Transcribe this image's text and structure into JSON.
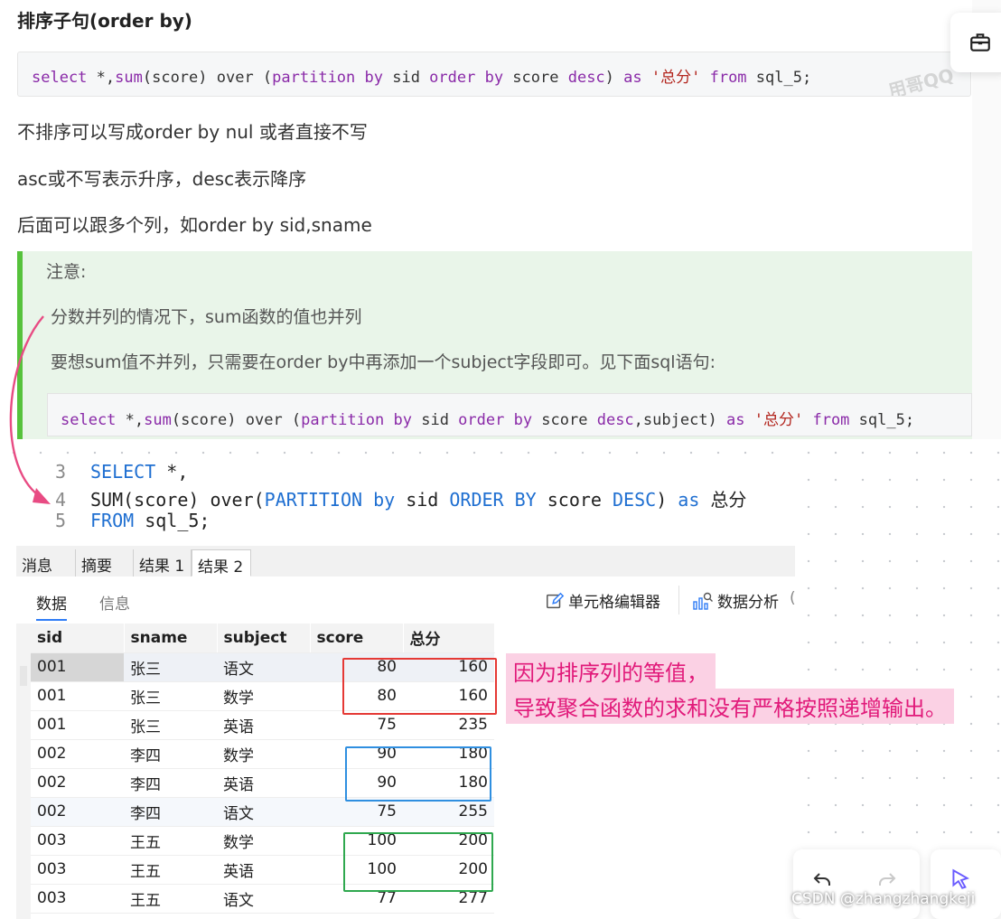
{
  "section_title": "排序子句(order by)",
  "code1": {
    "t1": "select",
    "t2": " *,",
    "t3": "sum",
    "t4": "(score) over (",
    "t5": "partition by",
    "t6": " sid ",
    "t7": "order by",
    "t8": " score ",
    "t9": "desc",
    "t10": ") ",
    "t11": "as",
    "t12": " '总分' ",
    "t13": "from",
    "t14": " sql_5;"
  },
  "paragraphs": {
    "p1": "不排序可以写成order by nul 或者直接不写",
    "p2": "asc或不写表示升序，desc表示降序",
    "p3": "后面可以跟多个列，如order by sid,sname"
  },
  "note": {
    "title": "注意:",
    "line1": "分数并列的情况下，sum函数的值也并列",
    "line2": "要想sum值不并列，只需要在order by中再添加一个subject字段即可。见下面sql语句:",
    "code": {
      "t1": "select",
      "t2": " *,",
      "t3": "sum",
      "t4": "(score) over (",
      "t5": "partition by",
      "t6": " sid ",
      "t7": "order by",
      "t8": " score ",
      "t9": "desc",
      "t10": ",subject) ",
      "t11": "as",
      "t12": " '总分' ",
      "t13": "from",
      "t14": " sql_5;"
    }
  },
  "watermark": "用哥QQ",
  "editor": {
    "lines": [
      {
        "num": "3",
        "k1": "SELECT",
        "p1": " *,",
        "k2": "",
        "p2": "",
        "k3": "",
        "p3": "",
        "k4": "",
        "p4": "",
        "k5": "",
        "p5": ""
      },
      {
        "num": "4",
        "k1": "",
        "p1": "SUM(score) over(",
        "k2": "PARTITION",
        "p2": " ",
        "k3": "by",
        "p3": " sid ",
        "k4": "ORDER BY",
        "p4": " score ",
        "k5": "DESC",
        "p5": ") "
      },
      {
        "num": "5",
        "k1": "FROM",
        "p1": " sql_5;",
        "k2": "",
        "p2": "",
        "k3": "",
        "p3": "",
        "k4": "",
        "p4": "",
        "k5": "",
        "p5": ""
      }
    ],
    "line4_tail_kw": "as",
    "line4_tail": " 总分"
  },
  "result_tabs": [
    "消息",
    "摘要",
    "结果 1",
    "结果 2"
  ],
  "sub_tabs": {
    "data": "数据",
    "info": "信息"
  },
  "tools": {
    "cell_editor": "单元格编辑器",
    "data_analysis": "数据分析",
    "more": "("
  },
  "table": {
    "columns": [
      "sid",
      "sname",
      "subject",
      "score",
      "总分"
    ],
    "rows": [
      [
        "001",
        "张三",
        "语文",
        "80",
        "160"
      ],
      [
        "001",
        "张三",
        "数学",
        "80",
        "160"
      ],
      [
        "001",
        "张三",
        "英语",
        "75",
        "235"
      ],
      [
        "002",
        "李四",
        "数学",
        "90",
        "180"
      ],
      [
        "002",
        "李四",
        "英语",
        "90",
        "180"
      ],
      [
        "002",
        "李四",
        "语文",
        "75",
        "255"
      ],
      [
        "003",
        "王五",
        "数学",
        "100",
        "200"
      ],
      [
        "003",
        "王五",
        "英语",
        "100",
        "200"
      ],
      [
        "003",
        "王五",
        "语文",
        "77",
        "277"
      ]
    ]
  },
  "annotation": {
    "line1": "因为排序列的等值，",
    "line2": "导致聚合函数的求和没有严格按照递增输出。"
  },
  "highlight_colors": {
    "red": "#e53935",
    "blue": "#2f8fe0",
    "green": "#2fa84f",
    "annotation": "#e11a7a"
  },
  "footer": "CSDN @zhangzhangkeji",
  "icons": {
    "toolbox": "toolbox-icon",
    "undo": "undo-icon",
    "redo": "redo-icon",
    "pointer": "pointer-icon",
    "pen": "pen-icon",
    "chart": "chart-icon"
  }
}
